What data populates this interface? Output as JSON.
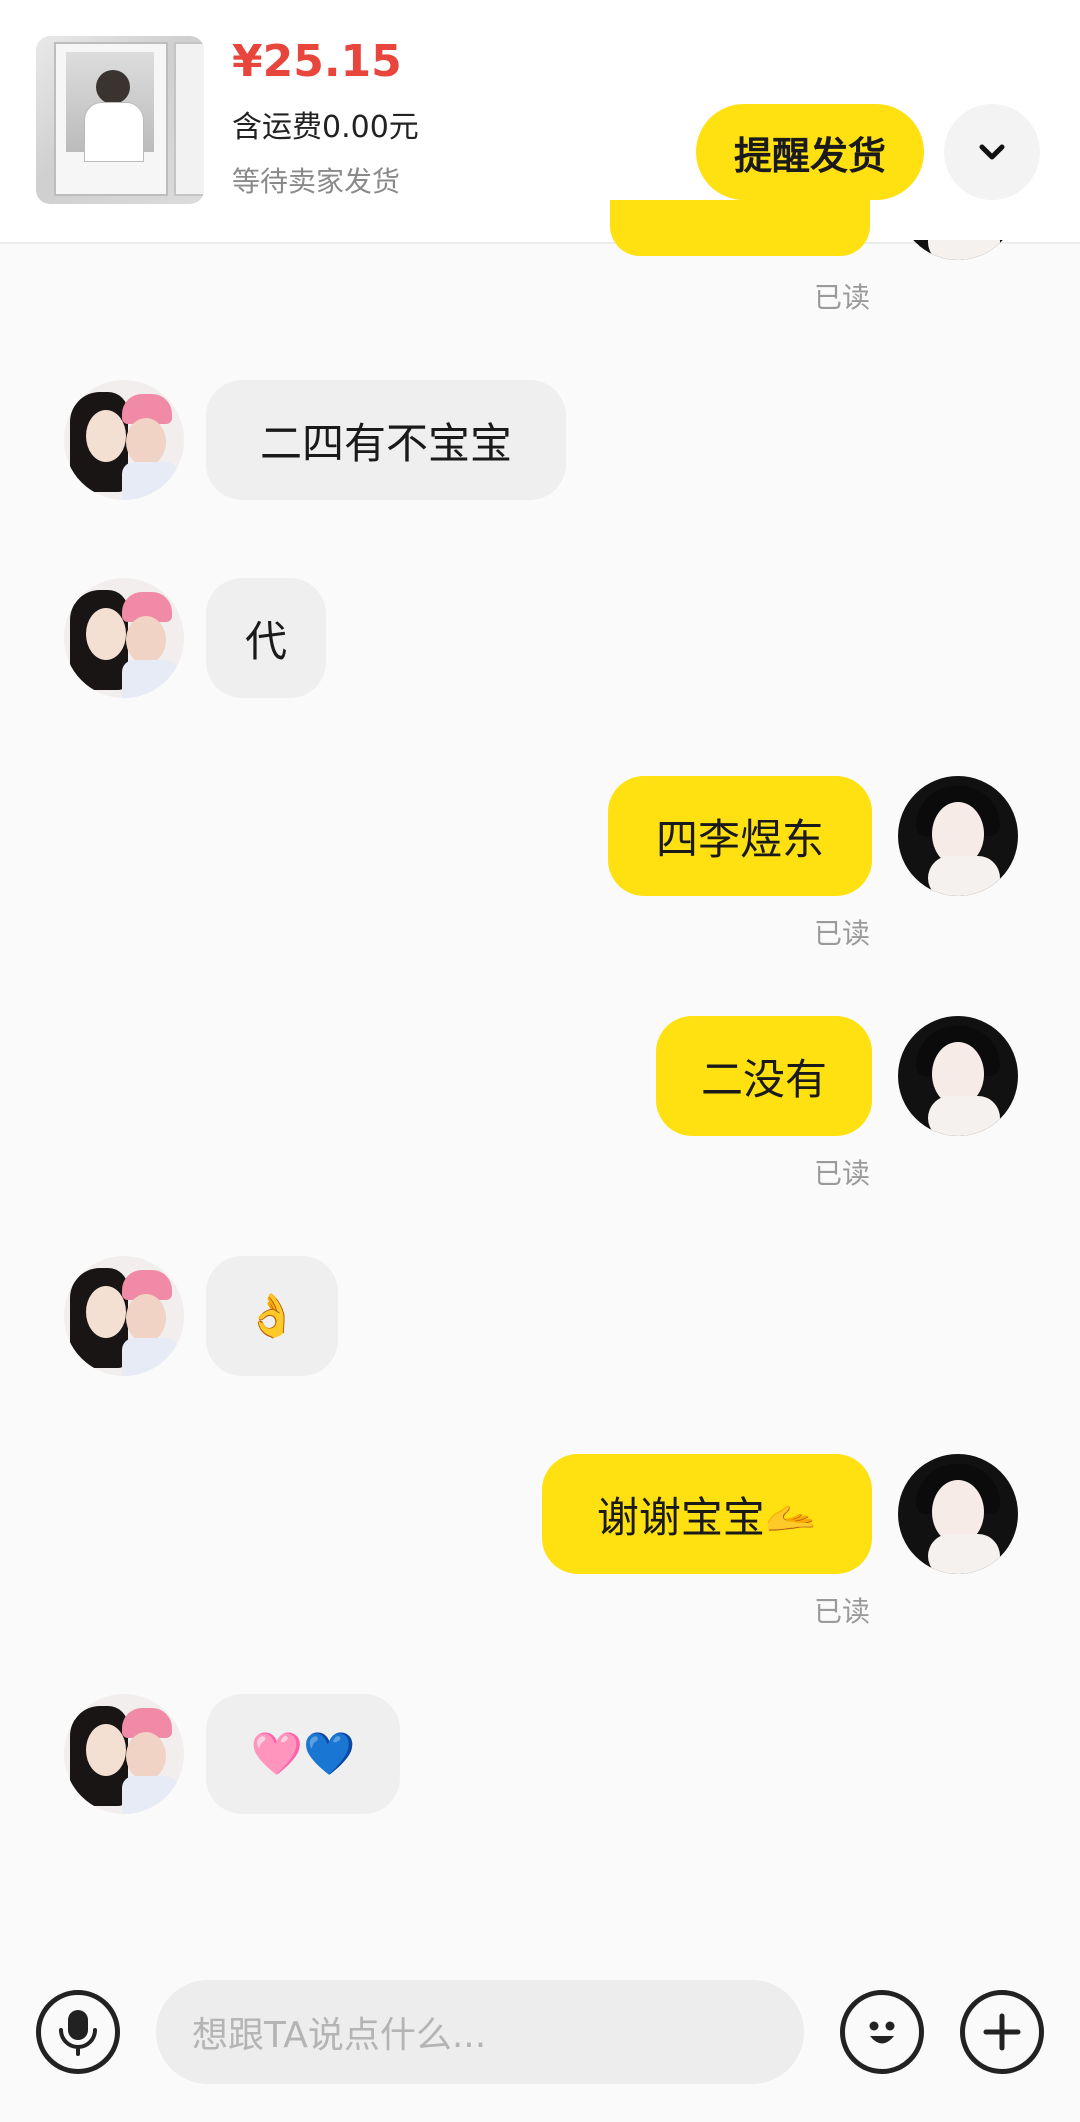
{
  "order": {
    "price": "¥25.15",
    "shipping": "含运费0.00元",
    "status": "等待卖家发货",
    "remind_button": "提醒发货"
  },
  "messages": [
    {
      "from": "other",
      "text": "二四有不宝宝"
    },
    {
      "from": "other",
      "text": "代"
    },
    {
      "from": "me",
      "text": "四李煜东",
      "read": "已读"
    },
    {
      "from": "me",
      "text": "二没有",
      "read": "已读"
    },
    {
      "from": "other",
      "text": "👌"
    },
    {
      "from": "me",
      "text": "谢谢宝宝🫴",
      "read": "已读"
    },
    {
      "from": "other",
      "text": "🩷💙"
    }
  ],
  "top_read": "已读",
  "composer": {
    "placeholder": "想跟TA说点什么..."
  },
  "icons": {
    "voice": "microphone-icon",
    "emoji": "smile-icon",
    "more": "plus-icon",
    "expand": "chevron-down-icon"
  },
  "colors": {
    "accent": "#ffe011",
    "price": "#e8453c",
    "incoming_bubble": "#efefef"
  }
}
